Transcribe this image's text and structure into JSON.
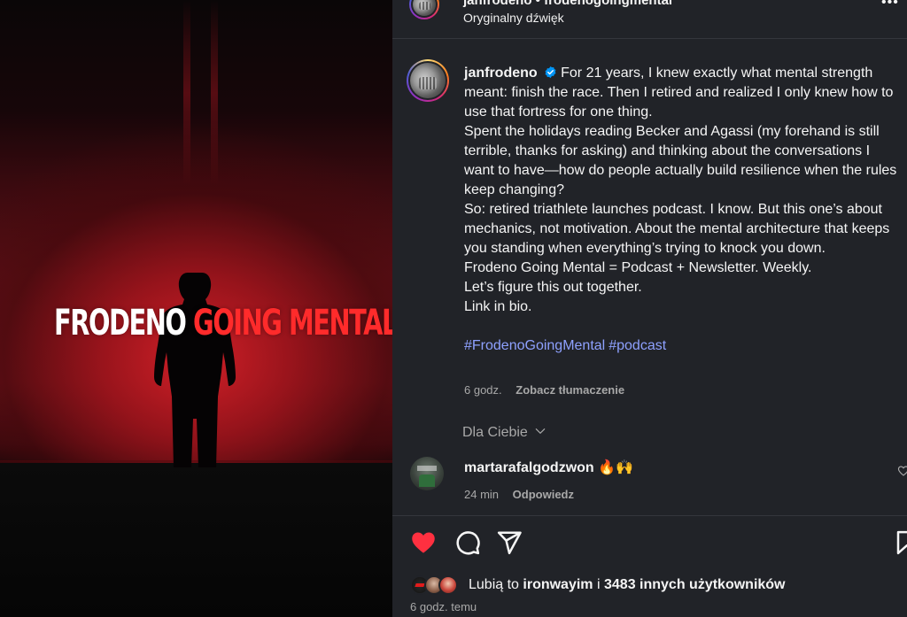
{
  "media": {
    "title_white": "FRODENO",
    "title_red": "GOING MENTAL",
    "title_colors": {
      "white": "#ffffff",
      "red": "#ff2b2b"
    }
  },
  "header": {
    "username": "janfrodeno • frodenogoingmental",
    "audio": "Oryginalny dźwięk",
    "more_label": "•••"
  },
  "caption": {
    "author": "janfrodeno",
    "paragraphs": [
      "For 21 years, I knew exactly what mental strength meant: finish the race. Then I retired and realized I only knew how to use that fortress for one thing.",
      "Spent the holidays reading Becker and Agassi (my forehand is still terrible, thanks for asking) and thinking about the conversations I want to have—how do people actually build resilience when the rules keep changing?",
      "So: retired triathlete launches podcast. I know. But this one’s about mechanics, not motivation. About the mental architecture that keeps you standing when everything’s trying to knock you down.",
      "Frodeno Going Mental = Podcast + Newsletter. Weekly.",
      "Let’s figure this out together.",
      "Link in bio."
    ],
    "hashtags": [
      "#FrodenoGoingMental",
      "#podcast"
    ],
    "time": "6 godz.",
    "translate_label": "Zobacz tłumaczenie"
  },
  "comments_sort": {
    "label": "Dla Ciebie"
  },
  "comments": [
    {
      "username": "martarafalgodzwon",
      "text": "🔥🙌",
      "time": "24 min",
      "reply_label": "Odpowiedz"
    }
  ],
  "likes": {
    "prefix": "Lubią to",
    "user": "ironwayim",
    "middle": "i",
    "others": "3483 innych użytkowników"
  },
  "post_time": "6 godz. temu",
  "colors": {
    "panel_bg": "#212328",
    "like_red": "#ff3040",
    "hashtag": "#8ea1ff",
    "verified_blue": "#0095f6",
    "muted": "#a8a8a8"
  }
}
